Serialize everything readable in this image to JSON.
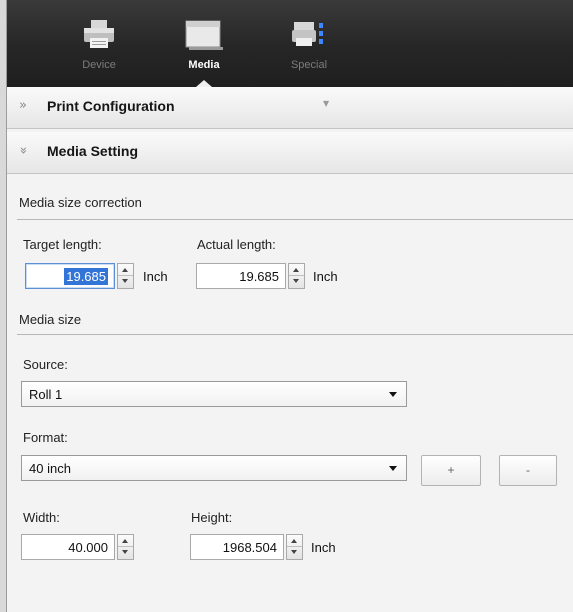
{
  "toolbar": {
    "items": [
      {
        "label": "Device",
        "icon": "printer-icon",
        "active": false
      },
      {
        "label": "Media",
        "icon": "media-icon",
        "active": true
      },
      {
        "label": "Special",
        "icon": "special-icon",
        "active": false
      }
    ]
  },
  "sections": {
    "print_configuration": {
      "title": "Print Configuration",
      "chevron": "»"
    },
    "media_setting": {
      "title": "Media Setting",
      "chevron": "»"
    }
  },
  "media_size_correction": {
    "heading": "Media size correction",
    "target_length": {
      "label": "Target length:",
      "value": "19.685",
      "unit": "Inch"
    },
    "actual_length": {
      "label": "Actual length:",
      "value": "19.685",
      "unit": "Inch"
    }
  },
  "media_size": {
    "heading": "Media size",
    "source": {
      "label": "Source:",
      "value": "Roll 1"
    },
    "format": {
      "label": "Format:",
      "value": "40 inch",
      "add_label": "+",
      "remove_label": "-"
    },
    "width": {
      "label": "Width:",
      "value": "40.000"
    },
    "height": {
      "label": "Height:",
      "value": "1968.504",
      "unit": "Inch"
    }
  },
  "colors": {
    "toolbar_bg": "#262626",
    "accent_focus": "#3375d6",
    "panel_bg": "#f3f3f3"
  }
}
